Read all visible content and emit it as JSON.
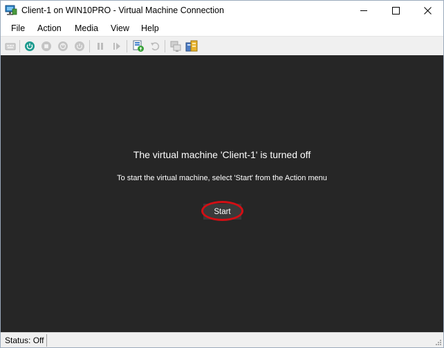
{
  "window": {
    "title": "Client-1 on WIN10PRO - Virtual Machine Connection"
  },
  "menu": {
    "items": [
      {
        "label": "File"
      },
      {
        "label": "Action"
      },
      {
        "label": "Media"
      },
      {
        "label": "View"
      },
      {
        "label": "Help"
      }
    ]
  },
  "toolbar": {
    "buttons": [
      {
        "icon": "ctrl-alt-del-icon",
        "enabled": false
      },
      {
        "icon": "start-icon",
        "enabled": true
      },
      {
        "icon": "turn-off-icon",
        "enabled": false
      },
      {
        "icon": "shut-down-icon",
        "enabled": false
      },
      {
        "icon": "save-icon",
        "enabled": false
      },
      {
        "icon": "pause-icon",
        "enabled": false
      },
      {
        "icon": "resume-icon",
        "enabled": false
      },
      {
        "icon": "checkpoint-icon",
        "enabled": true
      },
      {
        "icon": "revert-icon",
        "enabled": false
      },
      {
        "icon": "enhanced-session-icon",
        "enabled": false
      },
      {
        "icon": "share-icon",
        "enabled": true
      }
    ]
  },
  "viewport": {
    "heading": "The virtual machine 'Client-1' is turned off",
    "instruction": "To start the virtual machine, select 'Start' from the Action menu",
    "start_label": "Start",
    "background": "#262626"
  },
  "status": {
    "text": "Status: Off"
  },
  "colors": {
    "highlight_ring": "#d40e14",
    "start_icon": "#1c9a8e"
  }
}
